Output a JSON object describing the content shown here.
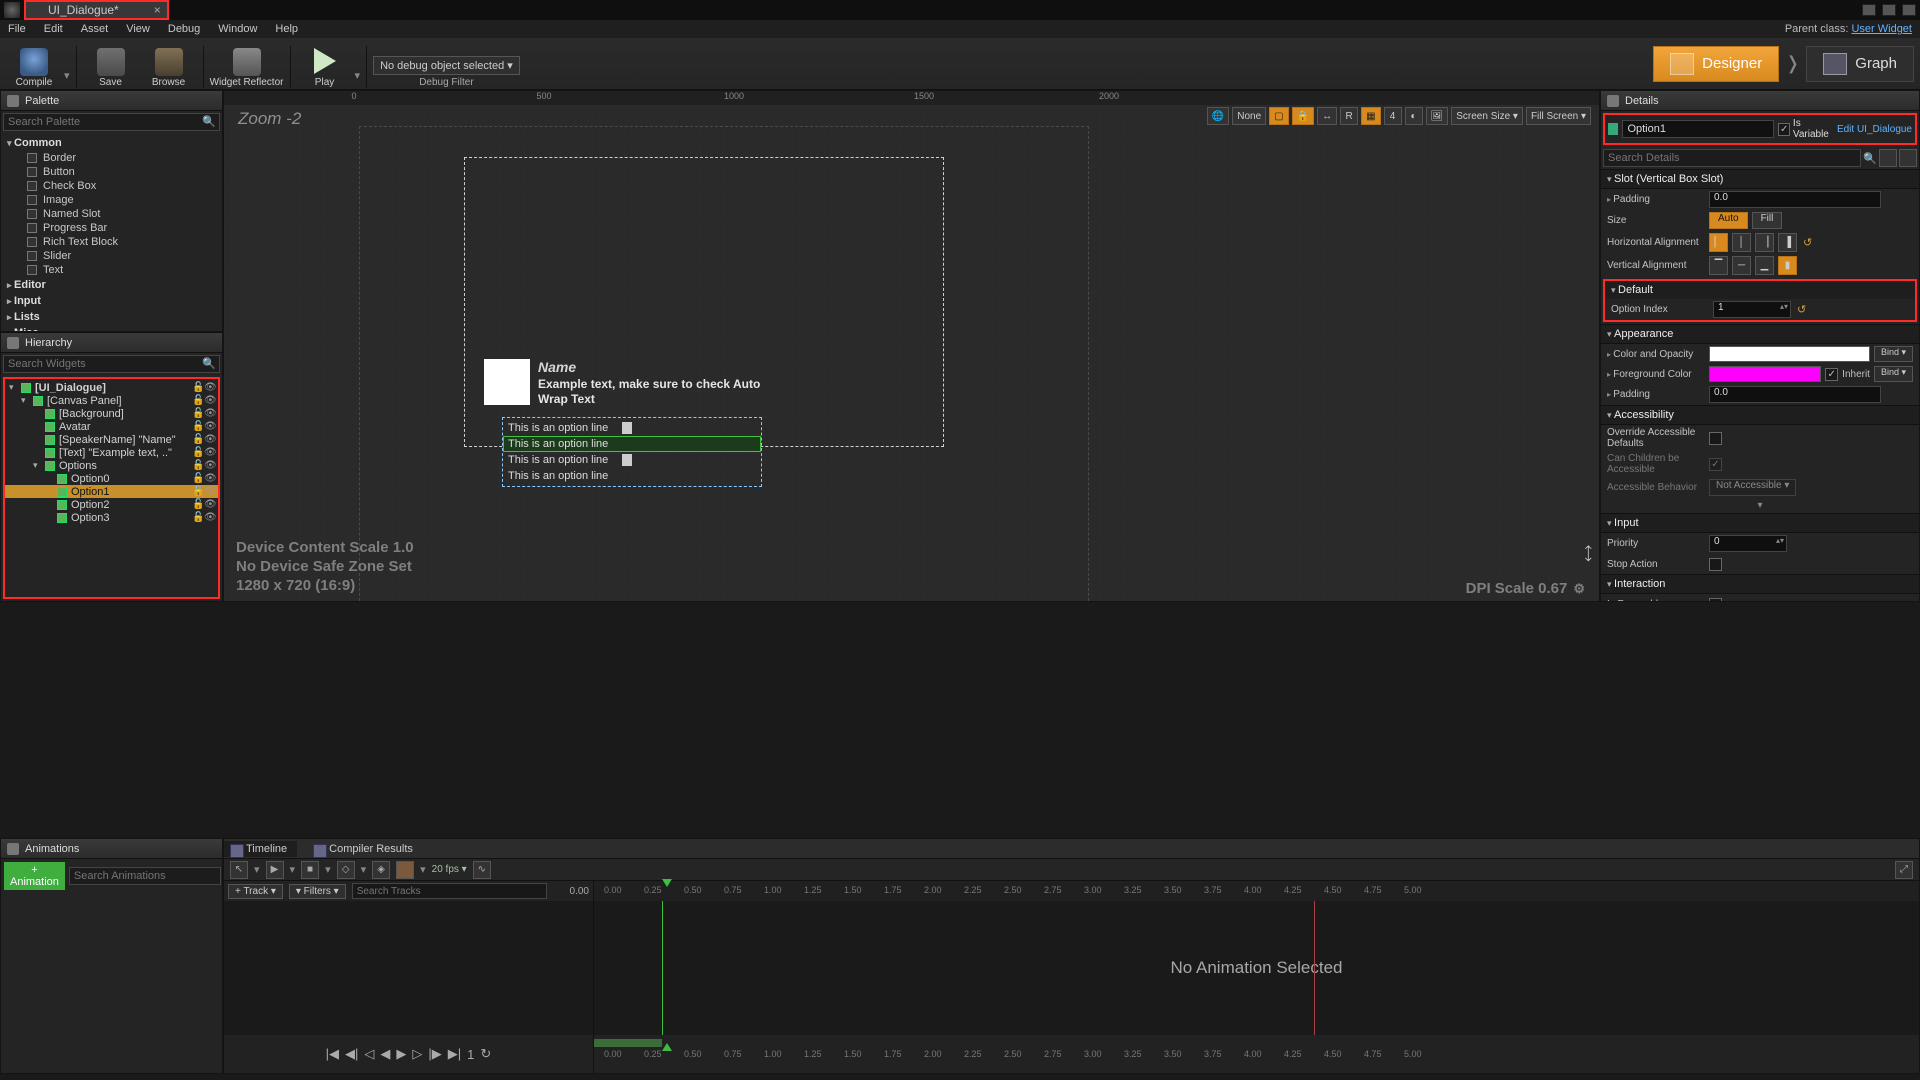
{
  "window": {
    "tab": "UI_Dialogue*",
    "parentClassLabel": "Parent class:",
    "parentClass": "User Widget"
  },
  "menu": [
    "File",
    "Edit",
    "Asset",
    "View",
    "Debug",
    "Window",
    "Help"
  ],
  "toolbar": {
    "compile": "Compile",
    "save": "Save",
    "browse": "Browse",
    "reflector": "Widget Reflector",
    "play": "Play",
    "debugSel": "No debug object selected ▾",
    "debugFilter": "Debug Filter",
    "designer": "Designer",
    "graph": "Graph"
  },
  "palette": {
    "title": "Palette",
    "search": "Search Palette",
    "common": {
      "title": "Common",
      "items": [
        "Border",
        "Button",
        "Check Box",
        "Image",
        "Named Slot",
        "Progress Bar",
        "Rich Text Block",
        "Slider",
        "Text"
      ]
    },
    "cats": [
      "Editor",
      "Input",
      "Lists",
      "Misc"
    ]
  },
  "hierarchy": {
    "title": "Hierarchy",
    "search": "Search Widgets",
    "nodes": [
      {
        "d": 0,
        "name": "[UI_Dialogue]",
        "exp": true,
        "root": true
      },
      {
        "d": 1,
        "name": "[Canvas Panel]",
        "exp": true
      },
      {
        "d": 2,
        "name": "[Background]"
      },
      {
        "d": 2,
        "name": "Avatar"
      },
      {
        "d": 2,
        "name": "[SpeakerName] \"Name\""
      },
      {
        "d": 2,
        "name": "[Text] \"Example text, ..\""
      },
      {
        "d": 2,
        "name": "Options",
        "exp": true
      },
      {
        "d": 3,
        "name": "Option0"
      },
      {
        "d": 3,
        "name": "Option1",
        "sel": true
      },
      {
        "d": 3,
        "name": "Option2"
      },
      {
        "d": 3,
        "name": "Option3"
      }
    ]
  },
  "viewport": {
    "zoom": "Zoom -2",
    "rulerTop": [
      {
        "p": 130,
        "v": "0"
      },
      {
        "p": 320,
        "v": "500"
      },
      {
        "p": 510,
        "v": "1000"
      },
      {
        "p": 700,
        "v": "1500"
      },
      {
        "p": 885,
        "v": "2000"
      }
    ],
    "controls": {
      "none": "None",
      "r": "R",
      "grid": "4",
      "screenSize": "Screen Size ▾",
      "fillScreen": "Fill Screen ▾"
    },
    "speakerName": "Name",
    "speakerText": "Example text, make sure to check Auto Wrap Text",
    "options": [
      "This is an option line",
      "This is an option line",
      "This is an option line",
      "This is an option line"
    ],
    "selectedOption": 1,
    "dev1": "Device Content Scale 1.0",
    "dev2": "No Device Safe Zone Set",
    "dev3": "1280 x 720 (16:9)",
    "dpi": "DPI Scale 0.67"
  },
  "details": {
    "title": "Details",
    "objectName": "Option1",
    "isVariable": "Is Variable",
    "editBP": "Edit UI_Dialogue",
    "searchPH": "Search Details",
    "slot": {
      "title": "Slot (Vertical Box Slot)",
      "padding": "Padding",
      "paddingVal": "0.0",
      "size": "Size",
      "auto": "Auto",
      "fill": "Fill",
      "halign": "Horizontal Alignment",
      "valign": "Vertical Alignment"
    },
    "default": {
      "title": "Default",
      "optIdx": "Option Index",
      "optIdxVal": "1"
    },
    "appearance": {
      "title": "Appearance",
      "cao": "Color and Opacity",
      "fg": "Foreground Color",
      "inherit": "Inherit",
      "pad": "Padding",
      "padVal": "0.0",
      "bind": "Bind ▾"
    },
    "accessibility": {
      "title": "Accessibility",
      "override": "Override Accessible Defaults",
      "children": "Can Children be Accessible",
      "behavior": "Accessible Behavior",
      "behaviorVal": "Not Accessible ▾"
    },
    "input": {
      "title": "Input",
      "priority": "Priority",
      "priorityVal": "0",
      "stop": "Stop Action"
    },
    "interaction": {
      "title": "Interaction",
      "focus": "Is Focusable"
    }
  },
  "animations": {
    "title": "Animations",
    "add": "+ Animation",
    "search": "Search Animations"
  },
  "timeline": {
    "tabs": [
      "Timeline",
      "Compiler Results"
    ],
    "fps": "20 fps ▾",
    "track": "+ Track ▾",
    "filters": "▾ Filters ▾",
    "searchPH": "Search Tracks",
    "headTime": "0.00",
    "rulerTicks": [
      "0.00",
      "0.25",
      "0.50",
      "0.75",
      "1.00",
      "1.25",
      "1.50",
      "1.75",
      "2.00",
      "2.25",
      "2.50",
      "2.75",
      "3.00",
      "3.25",
      "3.50",
      "3.75",
      "4.00",
      "4.25",
      "4.50",
      "4.75",
      "5.00"
    ],
    "noAnim": "No Animation Selected",
    "playFrame": "1"
  }
}
